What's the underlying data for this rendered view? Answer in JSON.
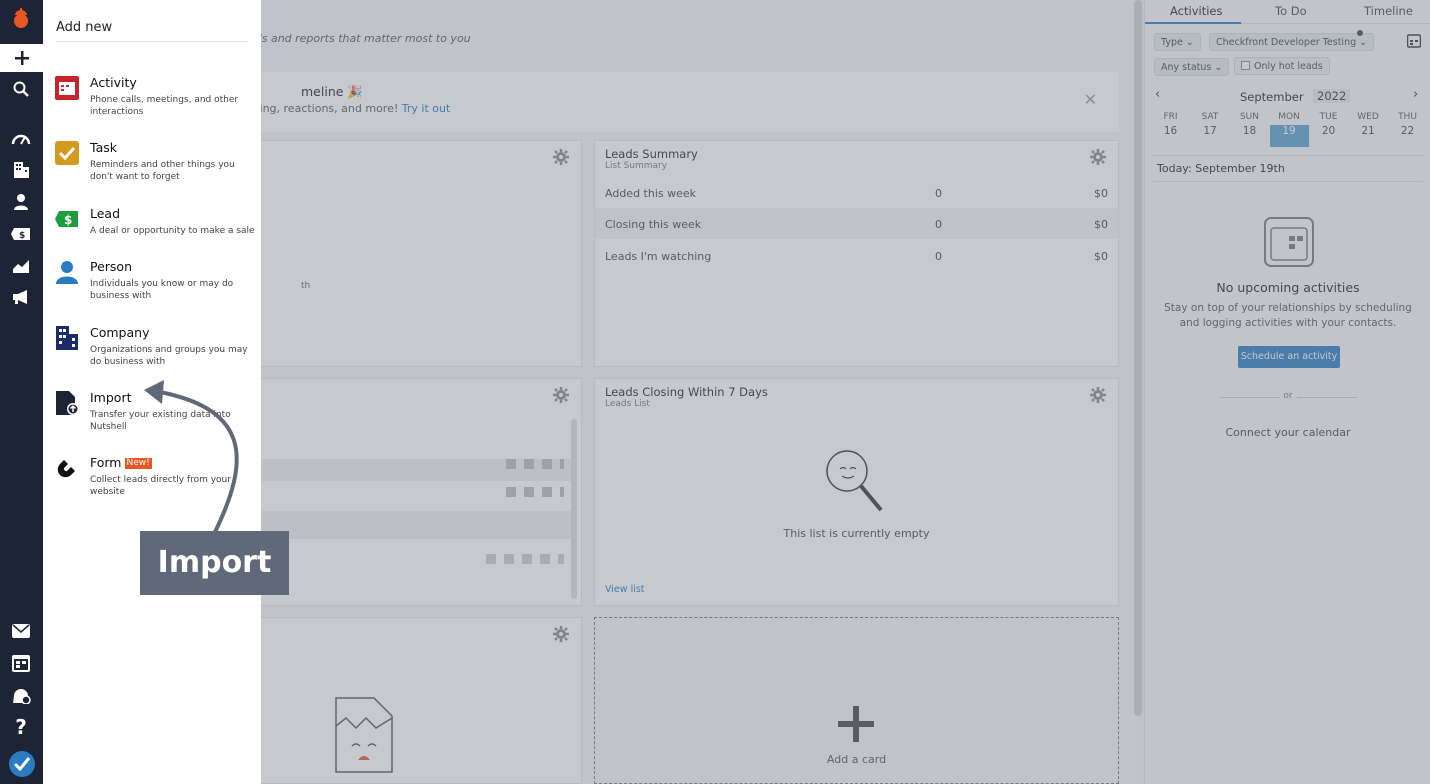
{
  "nav": {
    "items": [
      "logo-icon",
      "add-icon",
      "search-icon",
      "dashboard-icon",
      "companies-icon",
      "people-icon",
      "leads-icon",
      "reports-icon",
      "marketing-icon",
      "email-icon",
      "calendar-icon",
      "help-chat-icon",
      "help-icon",
      "check-icon"
    ]
  },
  "add_panel": {
    "title": "Add new",
    "items": [
      {
        "title": "Activity",
        "desc": "Phone calls, meetings, and other interactions",
        "icon": "activity-icon",
        "color": "#c8222c"
      },
      {
        "title": "Task",
        "desc": "Reminders and other things you don't want to forget",
        "icon": "task-icon",
        "color": "#d39b1c"
      },
      {
        "title": "Lead",
        "desc": "A deal or opportunity to make a sale",
        "icon": "lead-icon",
        "color": "#1f9d3c"
      },
      {
        "title": "Person",
        "desc": "Individuals you know or may do business with",
        "icon": "person-icon",
        "color": "#2a7bc2"
      },
      {
        "title": "Company",
        "desc": "Organizations and groups you may do business with",
        "icon": "company-icon",
        "color": "#1b2b6b"
      },
      {
        "title": "Import",
        "desc": "Transfer your existing data into Nutshell",
        "icon": "import-icon",
        "color": "#1c2436"
      },
      {
        "title": "Form",
        "badge": "New!",
        "desc": "Collect leads directly from your website",
        "icon": "form-magnet-icon",
        "color": "#111111"
      }
    ]
  },
  "main": {
    "subtitle": "ads and reports that matter most to you",
    "banner": {
      "title": "meline 🎉",
      "text": "ring, reactions, and more! ",
      "link": "Try it out",
      "close": "✕"
    },
    "leads_summary": {
      "title": "Leads Summary",
      "subtitle": "List Summary",
      "rows": [
        {
          "label": "Added this week",
          "count": "0",
          "amount": "$0"
        },
        {
          "label": "Closing this week",
          "count": "0",
          "amount": "$0"
        },
        {
          "label": "Leads I'm watching",
          "count": "0",
          "amount": "$0"
        }
      ]
    },
    "left_card_fragment": "th",
    "leads_closing": {
      "title": "Leads Closing Within 7 Days",
      "subtitle": "Leads List",
      "empty": "This list is currently empty",
      "view_list": "View list"
    },
    "add_card": "Add a card"
  },
  "right_panel": {
    "tabs": [
      "Activities",
      "To Do",
      "Timeline"
    ],
    "filters": {
      "type": "Type",
      "owner": "Checkfront Developer Testing",
      "status": "Any status",
      "hot_leads": "Only hot leads"
    },
    "calendar": {
      "month": "September",
      "year": "2022",
      "days": [
        {
          "name": "FRI",
          "date": "16"
        },
        {
          "name": "SAT",
          "date": "17"
        },
        {
          "name": "SUN",
          "date": "18"
        },
        {
          "name": "MON",
          "date": "19",
          "selected": true
        },
        {
          "name": "TUE",
          "date": "20"
        },
        {
          "name": "WED",
          "date": "21"
        },
        {
          "name": "THU",
          "date": "22"
        }
      ]
    },
    "today": "Today: September 19th",
    "empty_title": "No upcoming activities",
    "empty_text": "Stay on top of your relationships by scheduling and logging activities with your contacts.",
    "schedule_button": "Schedule an activity",
    "or": "or",
    "connect": "Connect your calendar"
  },
  "annotation": {
    "label": "Import"
  },
  "colors": {
    "nav_bg": "#1c2436",
    "accent": "#2a7bc2",
    "badge": "#e8571f"
  }
}
